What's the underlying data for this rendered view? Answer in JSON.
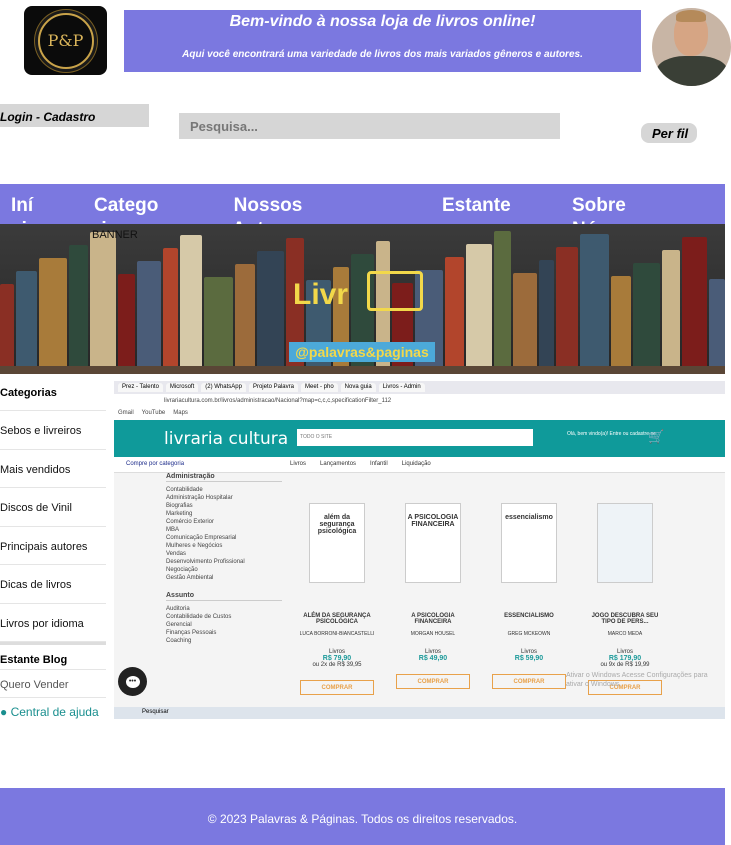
{
  "header": {
    "logo_text": "P&P",
    "welcome_title": "Bem-vindo à nossa loja de livros online!",
    "welcome_subtitle": "Aqui você encontrará uma variedade de livros dos mais variados gêneros e autores.",
    "login_label": "Login - Cadastro",
    "search_placeholder": "Pesquisa...",
    "profile_label": "Per fil"
  },
  "nav": {
    "items": [
      "Iní cio",
      "Catego ria",
      "Nossos Autores",
      "Estante",
      "Sobre Nós"
    ]
  },
  "banner": {
    "label": "BANNER",
    "title": "Livr",
    "handle": "@palavras&paginas"
  },
  "sidebar": {
    "title": "Categorias",
    "items": [
      "Sebos e livreiros",
      "Mais vendidos",
      "Discos de Vinil",
      "Principais autores",
      "Dicas de livros",
      "Livros por idioma"
    ],
    "section": "Estante Blog",
    "extra": "Quero Vender",
    "help": "Central de ajuda"
  },
  "screenshot": {
    "tabs": [
      "Prez - Talento",
      "Microsoft",
      "(2) WhatsApp",
      "Projeto Palavra",
      "Meet - pho",
      "Nova guia",
      "Livros - Admin"
    ],
    "url": "livrariacultura.com.br/livros/administracao/Nacional?map=c,c,c,specificationFilter_112",
    "bookmarks": [
      "Gmail",
      "YouTube",
      "Maps"
    ],
    "site_logo": "livraria cultura",
    "site_search": "TODO O SITE",
    "site_user": "Olá, bem vindo(a)! Entre ou cadastre-se",
    "site_nav": [
      "Compre por categoria",
      "Livros",
      "Lançamentos",
      "Infantil",
      "Liquidação"
    ],
    "filter_title": "Administração",
    "filters": [
      "Contabilidade",
      "Administração Hospitalar",
      "Biografias",
      "Marketing",
      "Comércio Exterior",
      "MBA",
      "Comunicação Empresarial",
      "Mulheres e Negócios",
      "Vendas",
      "Desenvolvimento Profissional",
      "Negociação",
      "Gestão Ambiental"
    ],
    "subject_title": "Assunto",
    "subjects": [
      "Auditoria",
      "Contabilidade de Custos",
      "Gerencial",
      "Finanças Pessoais",
      "Coaching"
    ],
    "products": [
      {
        "cover": "além da segurança psicológica",
        "name": "ALÉM DA SEGURANÇA PSICOLÓGICA",
        "author": "LUCA BORRONI-BIANCASTELLI",
        "type": "Livros",
        "price": "R$ 79,90",
        "installments": "ou 2x de R$ 39,95",
        "button": "COMPRAR"
      },
      {
        "cover": "A PSICOLOGIA FINANCEIRA",
        "name": "A PSICOLOGIA FINANCEIRA",
        "author": "MORGAN HOUSEL",
        "type": "Livros",
        "price": "R$ 49,90",
        "installments": "",
        "button": "COMPRAR"
      },
      {
        "cover": "essencialismo",
        "name": "ESSENCIALISMO",
        "author": "GREG MCKEOWN",
        "type": "Livros",
        "price": "R$ 59,90",
        "installments": "",
        "button": "COMPRAR"
      },
      {
        "cover": "",
        "name": "JOGO DESCUBRA SEU TIPO DE PERS...",
        "author": "MARCO MEDA",
        "type": "Livros",
        "price": "R$ 179,90",
        "installments": "ou 9x de R$ 19,99",
        "button": "COMPRAR"
      }
    ],
    "watermark": "Ativar o Windows Acesse Configurações para ativar o Windows.",
    "taskbar_search": "Pesquisar"
  },
  "footer": {
    "text": "© 2023 Palavras & Páginas. Todos os direitos reservados."
  },
  "colors": {
    "accent": "#7b78e0",
    "site_teal": "#0f9a9a"
  }
}
